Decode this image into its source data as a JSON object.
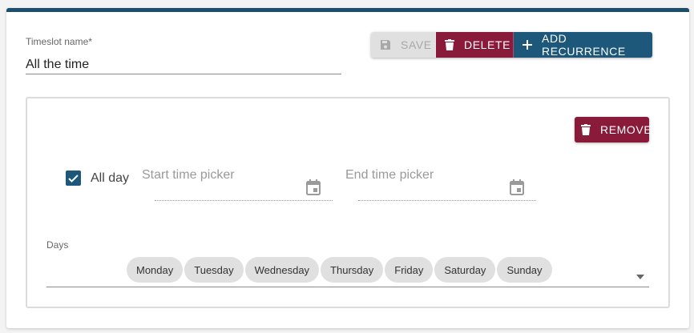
{
  "form": {
    "name_label": "Timeslot name",
    "name_required_mark": "*",
    "name_value": "All the time"
  },
  "toolbar": {
    "save_label": "SAVE",
    "delete_label": "DELETE",
    "add_recurrence_label": "ADD RECURRENCE",
    "icons": {
      "save": "floppy-disk-icon",
      "delete": "trash-icon",
      "add": "plus-icon"
    }
  },
  "recurrence": {
    "remove_label": "REMOVE",
    "all_day_label": "All day",
    "all_day_checked": true,
    "start_time_placeholder": "Start time picker",
    "end_time_placeholder": "End time picker",
    "days_label": "Days",
    "days": [
      "Monday",
      "Tuesday",
      "Wednesday",
      "Thursday",
      "Friday",
      "Saturday",
      "Sunday"
    ]
  },
  "colors": {
    "primary": "#1d587a",
    "danger": "#8a1a3a",
    "disabled": "#e0e0e0"
  }
}
